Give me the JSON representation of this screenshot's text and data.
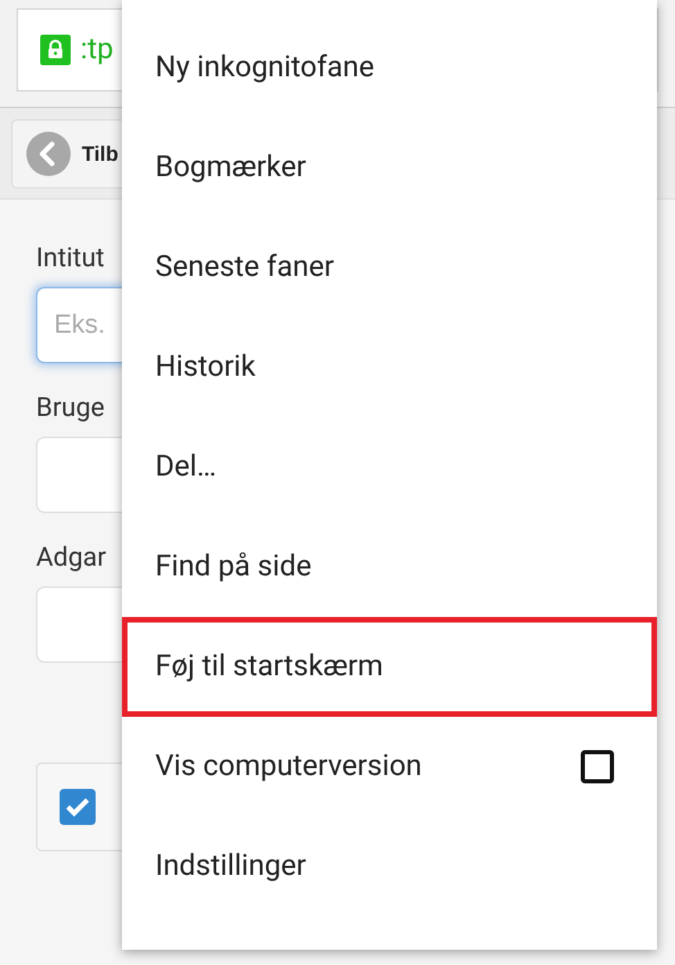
{
  "address_bar": {
    "url": ":tp",
    "secure": true
  },
  "toolbar": {
    "back_button": "Tilb"
  },
  "form": {
    "fields": [
      {
        "label": "Intitut",
        "placeholder": "Eks.",
        "focused": true
      },
      {
        "label": "Bruge",
        "focused": false
      },
      {
        "label": "Adgar",
        "focused": false
      }
    ],
    "remember": {
      "checked": true
    }
  },
  "menu": {
    "items": [
      {
        "kind": "action",
        "label": "Ny inkognitofane",
        "highlighted": false
      },
      {
        "kind": "action",
        "label": "Bogmærker",
        "highlighted": false
      },
      {
        "kind": "action",
        "label": "Seneste faner",
        "highlighted": false
      },
      {
        "kind": "action",
        "label": "Historik",
        "highlighted": false
      },
      {
        "kind": "action",
        "label": "Del…",
        "highlighted": false
      },
      {
        "kind": "action",
        "label": "Find på side",
        "highlighted": false
      },
      {
        "kind": "action",
        "label": "Føj til startskærm",
        "highlighted": true
      },
      {
        "kind": "checkbox",
        "label": "Vis computerversion",
        "highlighted": false,
        "checked": false
      },
      {
        "kind": "action",
        "label": "Indstillinger",
        "highlighted": false
      }
    ]
  }
}
